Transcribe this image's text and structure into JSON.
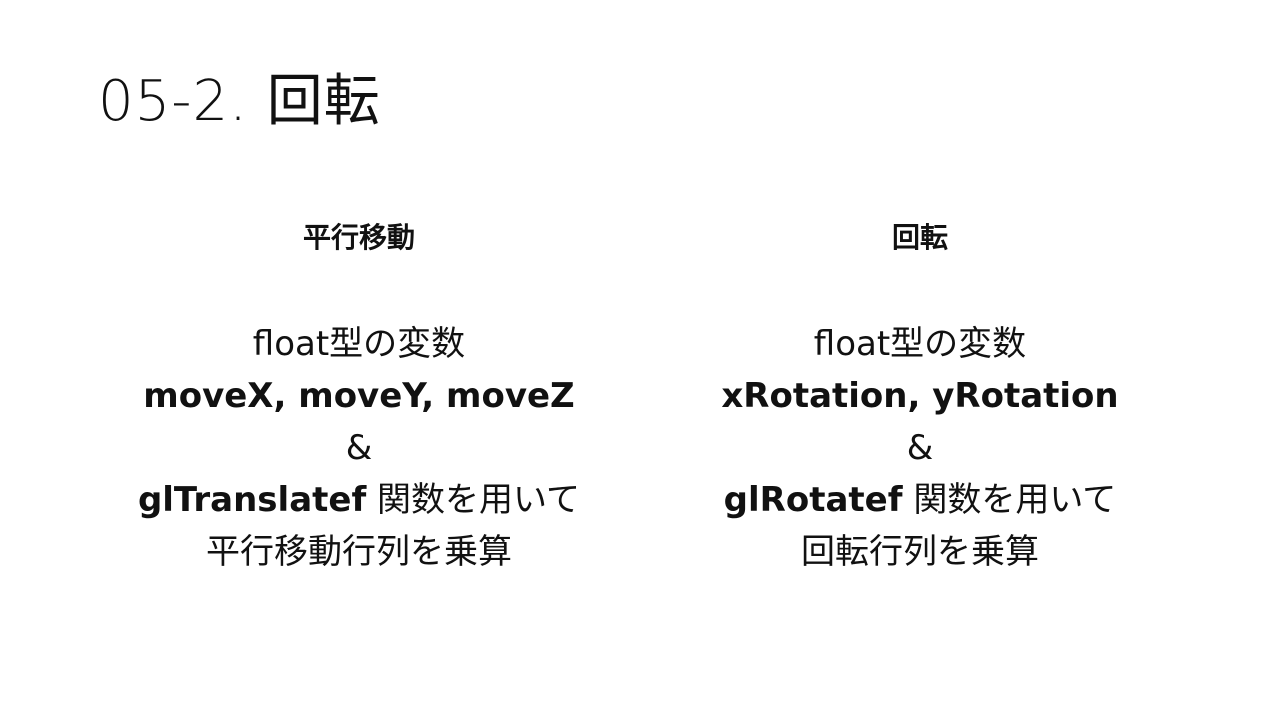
{
  "slide": {
    "title": "05-2. 回転"
  },
  "left_column": {
    "heading": "平行移動",
    "line1": "float型の変数",
    "line2": "moveX, moveY, moveZ",
    "line3": "&",
    "line4_bold": "glTranslatef",
    "line4_rest": " 関数を用いて",
    "line5": "平行移動行列を乗算"
  },
  "right_column": {
    "heading": "回転",
    "line1": "float型の変数",
    "line2": "xRotation, yRotation",
    "line3": "&",
    "line4_bold": "glRotatef",
    "line4_rest": " 関数を用いて",
    "line5": "回転行列を乗算"
  }
}
